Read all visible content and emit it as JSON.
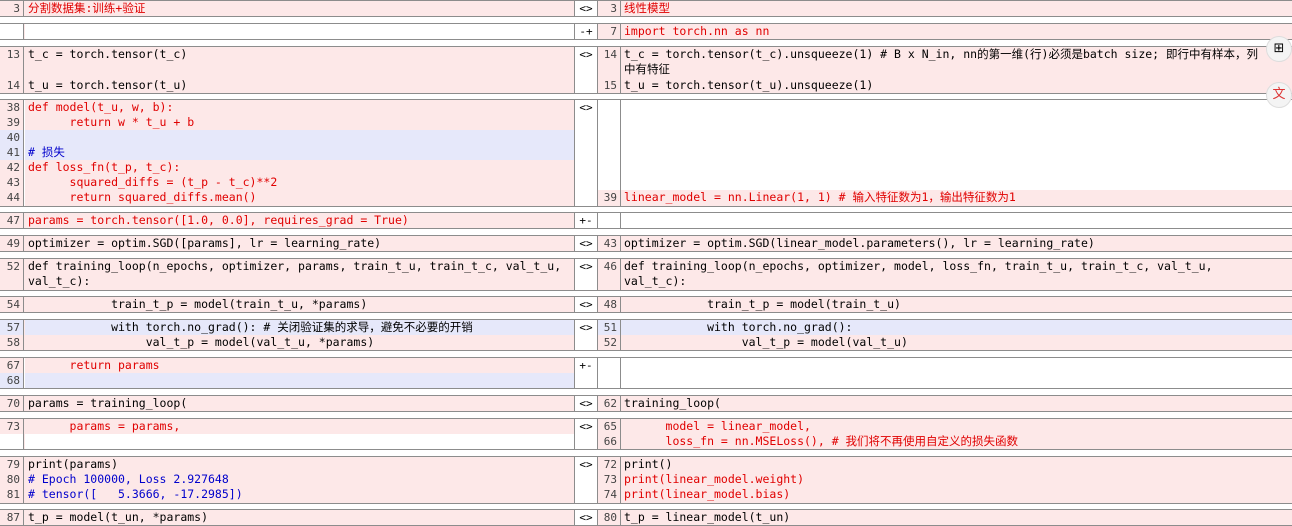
{
  "colors": {
    "changed": "#fde8e8",
    "inserted": "#e6e8fa",
    "border": "#8c8c8c",
    "accent": "#e00000",
    "comment": "#0000cc"
  },
  "blocks": [
    {
      "left": {
        "nums": [
          "3"
        ],
        "lines": [
          "分割数据集:训练+验证"
        ]
      },
      "mid": "<>",
      "right": {
        "nums": [
          "3"
        ],
        "lines": [
          "线性模型"
        ]
      }
    },
    {
      "left": {
        "nums": [],
        "lines": []
      },
      "mid": "-+",
      "right": {
        "nums": [
          "7"
        ],
        "lines": [
          "import torch.nn as nn"
        ]
      }
    },
    {
      "left": {
        "nums": [
          "13",
          "14"
        ],
        "lines": [
          "t_c = torch.tensor(t_c)",
          "t_u = torch.tensor(t_u)"
        ]
      },
      "mid": "<>",
      "right": {
        "nums": [
          "14",
          "15"
        ],
        "lines": [
          "t_c = torch.tensor(t_c).unsqueeze(1) # B x N_in, nn的第一维(行)必须是batch size; 即行中有样本，列中有特征",
          "t_u = torch.tensor(t_u).unsqueeze(1)"
        ]
      }
    },
    {
      "left": {
        "nums": [
          "38",
          "39",
          "40",
          "41",
          "42",
          "43",
          "44"
        ],
        "lines": [
          "def model(t_u, w, b):",
          "      return w * t_u + b",
          "",
          "# 损失",
          "def loss_fn(t_p, t_c):",
          "      squared_diffs = (t_p - t_c)**2",
          "      return squared_diffs.mean()"
        ]
      },
      "mid": "<>",
      "right": {
        "nums": [
          "39"
        ],
        "lines": [
          "linear_model = nn.Linear(1, 1) # 输入特征数为1，输出特征数为1"
        ]
      }
    },
    {
      "left": {
        "nums": [
          "47"
        ],
        "lines": [
          "params = torch.tensor([1.0, 0.0], requires_grad = True)"
        ]
      },
      "mid": "+-",
      "right": {
        "nums": [],
        "lines": []
      }
    },
    {
      "left": {
        "nums": [
          "49"
        ],
        "lines": [
          "optimizer = optim.SGD([params], lr = learning_rate)"
        ]
      },
      "mid": "<>",
      "right": {
        "nums": [
          "43"
        ],
        "lines": [
          "optimizer = optim.SGD(linear_model.parameters(), lr = learning_rate)"
        ]
      }
    },
    {
      "left": {
        "nums": [
          "52"
        ],
        "lines": [
          "def training_loop(n_epochs, optimizer, params, train_t_u, train_t_c, val_t_u, val_t_c):"
        ]
      },
      "mid": "<>",
      "right": {
        "nums": [
          "46"
        ],
        "lines": [
          "def training_loop(n_epochs, optimizer, model, loss_fn, train_t_u, train_t_c, val_t_u, val_t_c):"
        ]
      }
    },
    {
      "left": {
        "nums": [
          "54"
        ],
        "lines": [
          "            train_t_p = model(train_t_u, *params)"
        ]
      },
      "mid": "<>",
      "right": {
        "nums": [
          "48"
        ],
        "lines": [
          "            train_t_p = model(train_t_u)"
        ]
      }
    },
    {
      "left": {
        "nums": [
          "57",
          "58"
        ],
        "lines": [
          "            with torch.no_grad(): # 关闭验证集的求导，避免不必要的开销",
          "                 val_t_p = model(val_t_u, *params)"
        ]
      },
      "mid": "<>",
      "right": {
        "nums": [
          "51",
          "52"
        ],
        "lines": [
          "            with torch.no_grad():",
          "                 val_t_p = model(val_t_u)"
        ]
      }
    },
    {
      "left": {
        "nums": [
          "67",
          "68"
        ],
        "lines": [
          "      return params",
          ""
        ]
      },
      "mid": "+-",
      "right": {
        "nums": [],
        "lines": []
      }
    },
    {
      "left": {
        "nums": [
          "70"
        ],
        "lines": [
          "params = training_loop("
        ]
      },
      "mid": "<>",
      "right": {
        "nums": [
          "62"
        ],
        "lines": [
          "training_loop("
        ]
      }
    },
    {
      "left": {
        "nums": [
          "73"
        ],
        "lines": [
          "      params = params,"
        ]
      },
      "mid": "<>",
      "right": {
        "nums": [
          "65",
          "66"
        ],
        "lines": [
          "      model = linear_model,",
          "      loss_fn = nn.MSELoss(), # 我们将不再使用自定义的损失函数"
        ]
      }
    },
    {
      "left": {
        "nums": [
          "79",
          "80",
          "81"
        ],
        "lines": [
          "print(params)",
          "# Epoch 100000, Loss 2.927648",
          "# tensor([   5.3666, -17.2985])"
        ]
      },
      "mid": "<>",
      "right": {
        "nums": [
          "72",
          "73",
          "74"
        ],
        "lines": [
          "print()",
          "print(linear_model.weight)",
          "print(linear_model.bias)"
        ]
      }
    },
    {
      "left": {
        "nums": [
          "87"
        ],
        "lines": [
          "t_p = model(t_un, *params)"
        ]
      },
      "mid": "<>",
      "right": {
        "nums": [
          "80"
        ],
        "lines": [
          "t_p = linear_model(t_un)"
        ]
      }
    }
  ],
  "side_icons": [
    {
      "name": "grid-icon",
      "glyph": "⊞"
    },
    {
      "name": "translate-icon",
      "glyph": "文"
    }
  ]
}
